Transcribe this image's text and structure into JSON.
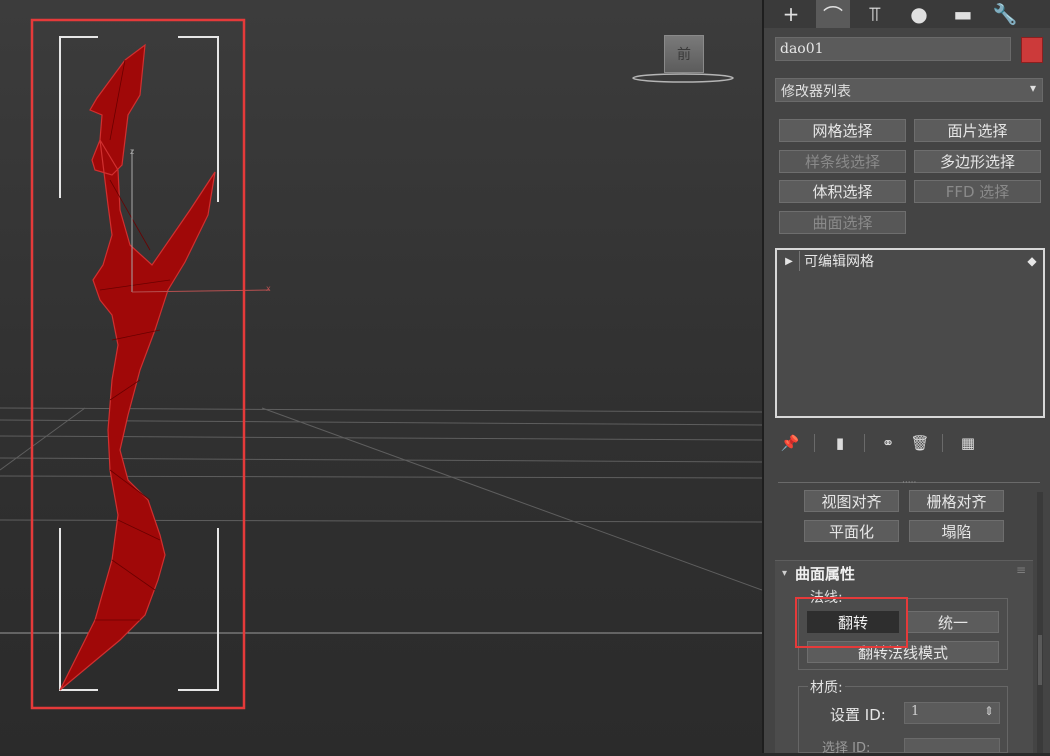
{
  "viewport": {
    "viewcube_label": "前",
    "highlight_color": "#e53a3a",
    "object_color": "#a00808"
  },
  "command_panel": {
    "tabs": [
      {
        "icon": "plus-icon",
        "glyph": "+"
      },
      {
        "icon": "modify-curve-icon",
        "glyph": "⌒"
      },
      {
        "icon": "hierarchy-icon",
        "glyph": "⫪"
      },
      {
        "icon": "motion-circle-icon",
        "glyph": "●"
      },
      {
        "icon": "display-monitor-icon",
        "glyph": "▬"
      },
      {
        "icon": "utilities-wrench-icon",
        "glyph": "🔧"
      }
    ],
    "object_name": "dao01",
    "object_color": "#cc3a3a",
    "modifier_list": "修改器列表",
    "modifier_list_arrow": "▾",
    "modifier_buttons": [
      {
        "label": "网格选择",
        "enabled": true
      },
      {
        "label": "面片选择",
        "enabled": true
      },
      {
        "label": "样条线选择",
        "enabled": false
      },
      {
        "label": "多边形选择",
        "enabled": true
      },
      {
        "label": "体积选择",
        "enabled": true
      },
      {
        "label": "FFD 选择",
        "enabled": false
      },
      {
        "label": "曲面选择",
        "enabled": false
      }
    ],
    "stack": {
      "items": [
        {
          "label": "可编辑网格",
          "expand_glyph": "▶",
          "type_glyph": "◆"
        }
      ]
    },
    "stack_tools": [
      {
        "icon": "pin-icon",
        "glyph": "📌"
      },
      {
        "icon": "show-end-result-icon",
        "glyph": "▮"
      },
      {
        "icon": "make-unique-icon",
        "glyph": "⚭"
      },
      {
        "icon": "remove-modifier-icon",
        "glyph": "🗑"
      },
      {
        "icon": "configure-sets-icon",
        "glyph": "▦"
      }
    ],
    "scroll_grip": "·····",
    "align_buttons": [
      "视图对齐",
      "栅格对齐"
    ],
    "flatten_buttons": [
      "平面化",
      "塌陷"
    ],
    "surface_props": {
      "title": "曲面属性",
      "expand_glyph": "▾",
      "menu_glyph": "≡",
      "normals_label": "法线:",
      "flip_label": "翻转",
      "unify_label": "统一",
      "flip_mode_label": "翻转法线模式",
      "material_label": "材质:",
      "set_id_label": "设置 ID:",
      "set_id_value": "1",
      "spinner_glyph": "⇕",
      "select_id_label": "选择 ID:"
    }
  }
}
